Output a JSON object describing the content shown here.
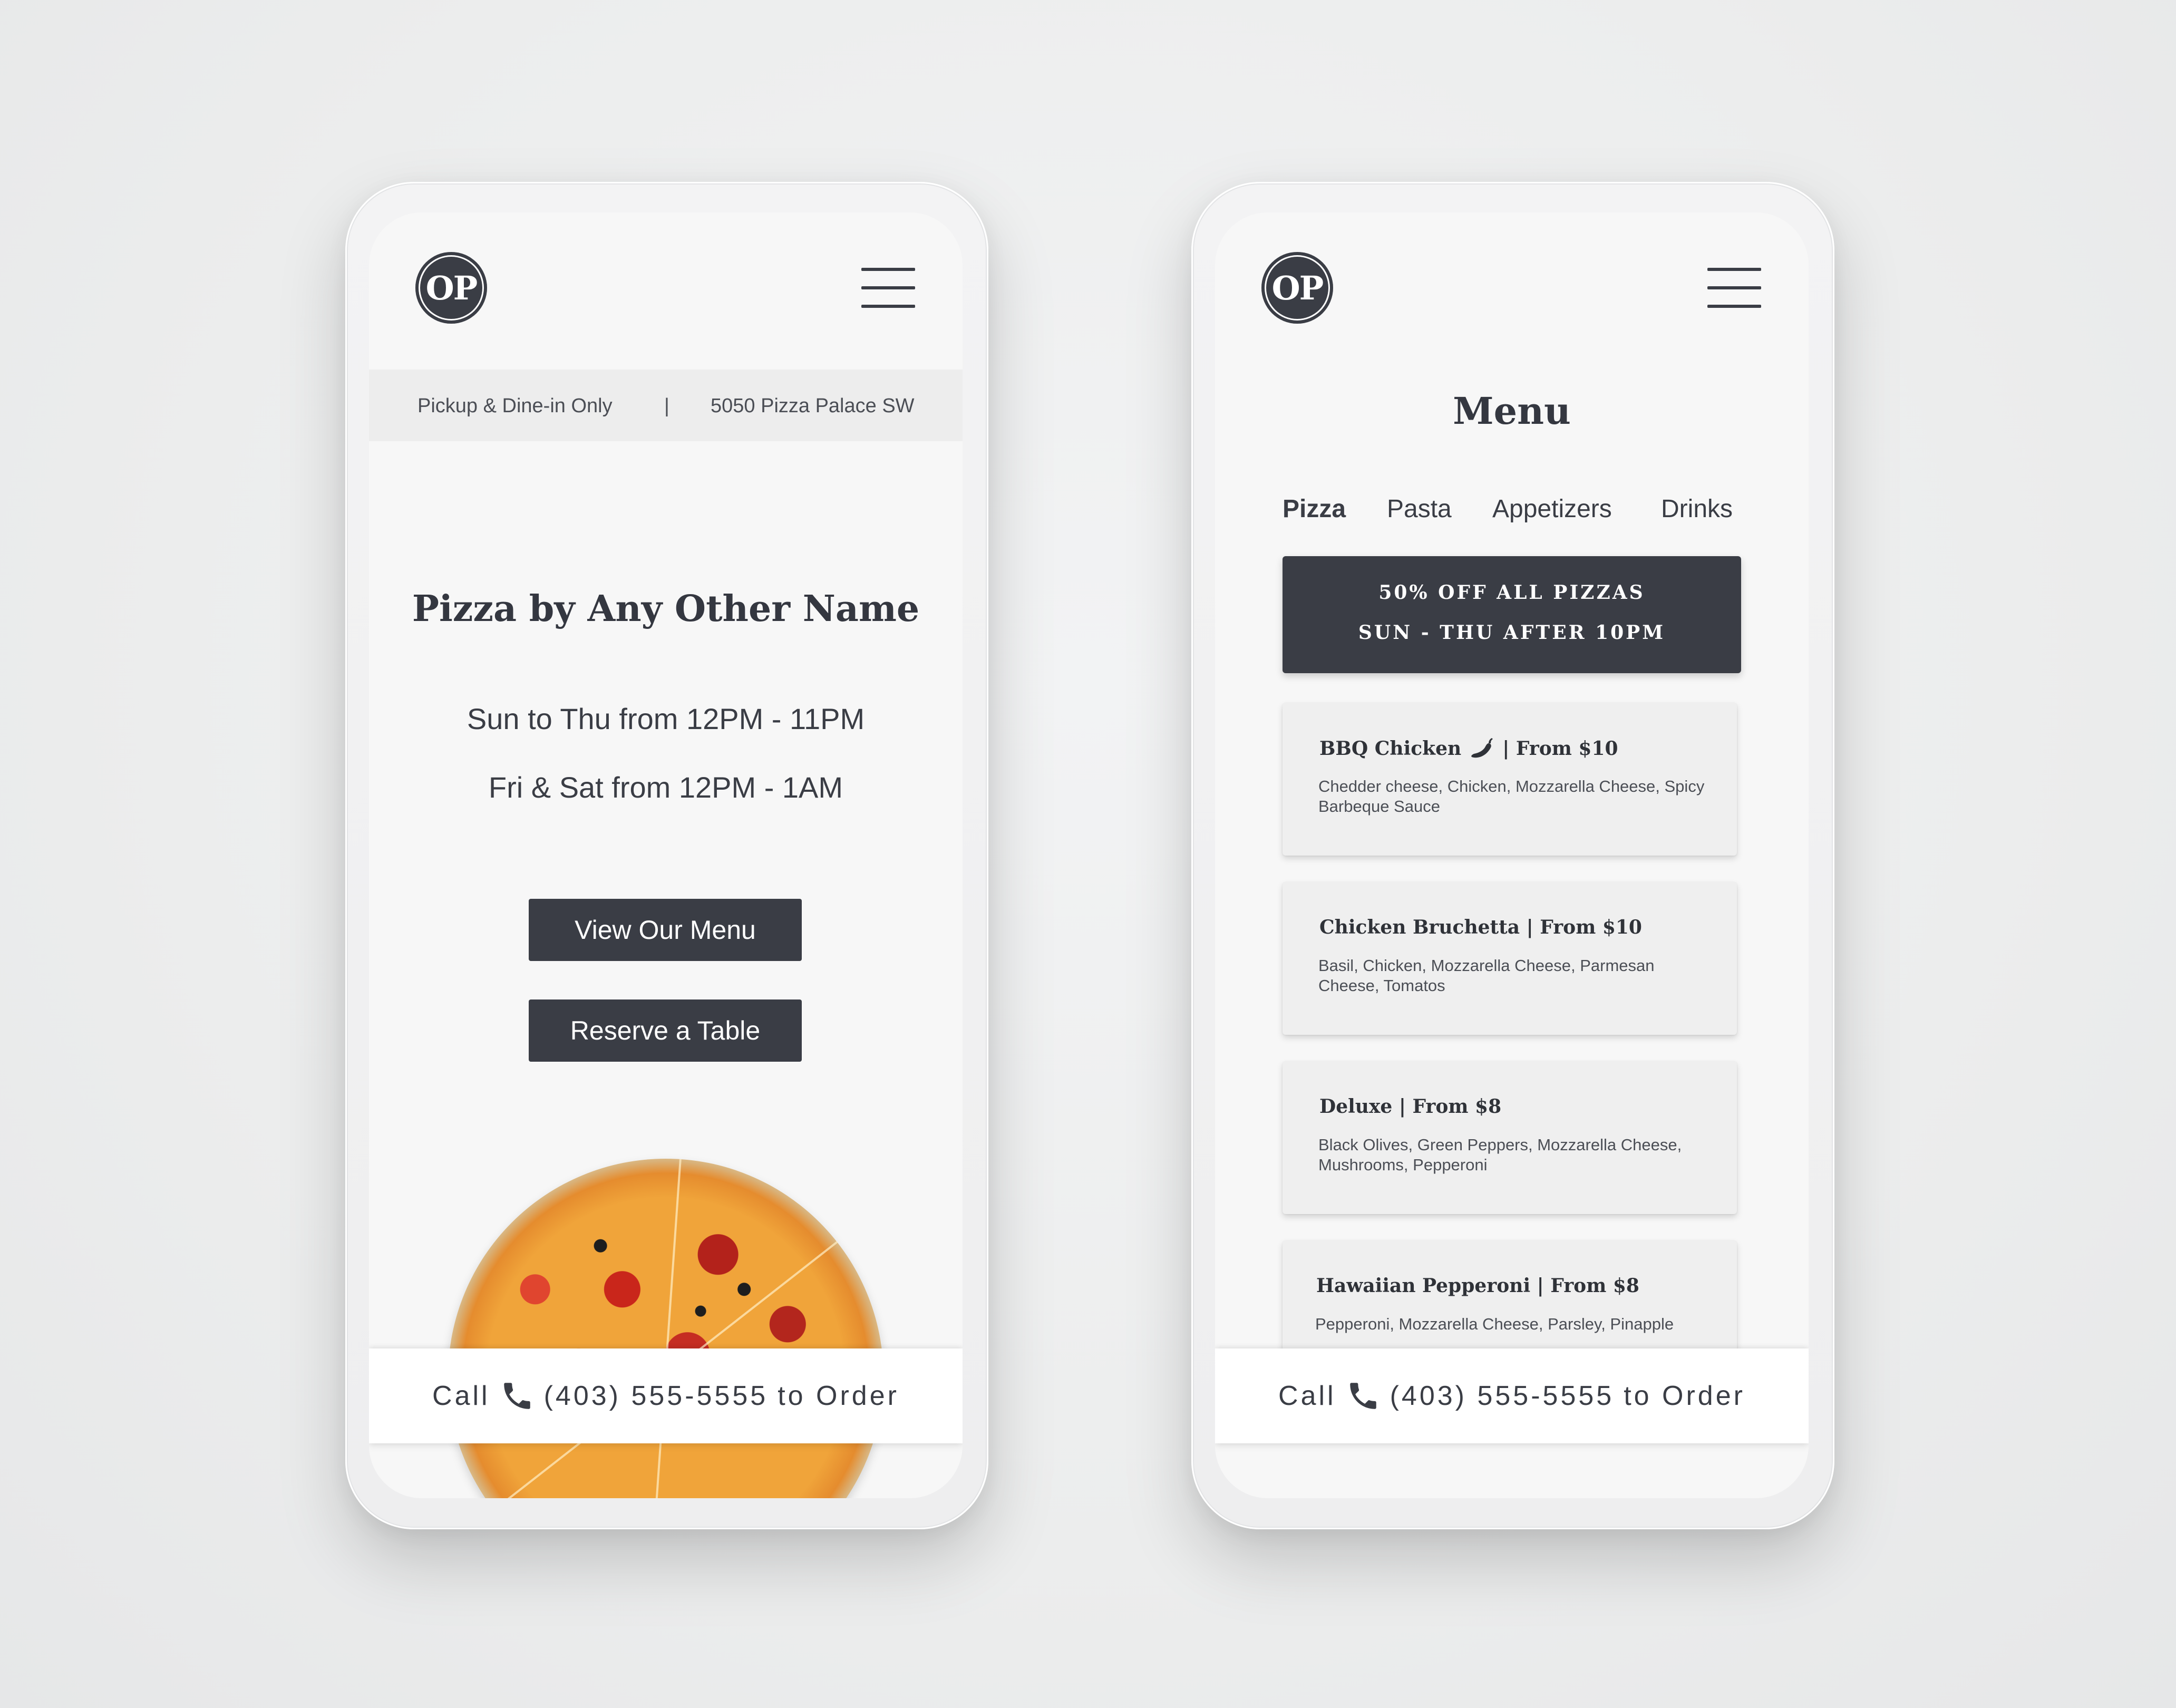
{
  "home": {
    "logo_text": "OP",
    "info": {
      "service": "Pickup & Dine-in Only",
      "separator": "|",
      "address": "5050 Pizza Palace SW"
    },
    "title": "Pizza by Any Other Name",
    "hours": [
      "Sun to Thu from 12PM - 11PM",
      "Fri & Sat from 12PM - 1AM"
    ],
    "buttons": {
      "view_menu": "View Our Menu",
      "reserve": "Reserve a Table"
    },
    "call": {
      "prefix": "Call",
      "phone": "(403) 555-5555",
      "suffix": "to Order"
    }
  },
  "menu": {
    "logo_text": "OP",
    "title": "Menu",
    "tabs": [
      {
        "label": "Pizza",
        "active": true
      },
      {
        "label": "Pasta"
      },
      {
        "label": "Appetizers"
      },
      {
        "label": "Drinks"
      }
    ],
    "promo": {
      "line1": "50% OFF ALL PIZZAS",
      "line2": "SUN - THU AFTER 10PM"
    },
    "items": [
      {
        "name": "BBQ Chicken",
        "price": "| From $10",
        "spicy": true,
        "description": "Chedder cheese, Chicken, Mozzarella Cheese, Spicy Barbeque Sauce"
      },
      {
        "name": "Chicken Bruchetta | From $10",
        "description": "Basil, Chicken, Mozzarella Cheese, Parmesan Cheese, Tomatos"
      },
      {
        "name": "Deluxe | From $8",
        "description": "Black Olives, Green Peppers, Mozzarella Cheese, Mushrooms, Pepperoni"
      },
      {
        "name": "Hawaiian Pepperoni | From $8",
        "description": "Pepperoni, Mozzarella Cheese, Parsley, Pinapple"
      }
    ],
    "call": {
      "prefix": "Call",
      "phone": "(403) 555-5555",
      "suffix": "to Order"
    }
  },
  "colors": {
    "primary": "#3a3d45",
    "screen_bg": "#f7f7f7",
    "info_bar": "#ededed",
    "card": "#efefef"
  },
  "icons": [
    "hamburger-menu-icon",
    "phone-icon",
    "chili-pepper-icon"
  ]
}
